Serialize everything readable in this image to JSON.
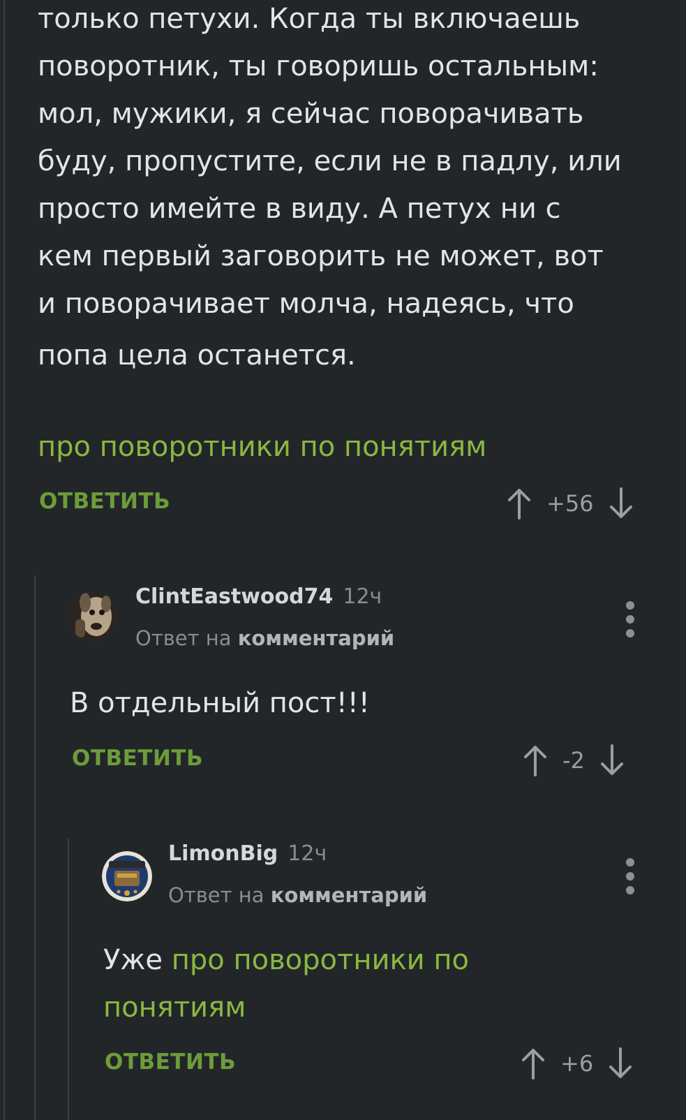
{
  "main_comment": {
    "lines": [
      "только петухи. Когда ты включаешь",
      "поворотник, ты говоришь остальным:",
      "мол, мужики, я сейчас поворачивать",
      "буду, пропустите, если не в падлу, или",
      "просто имейте в виду. А петух ни с",
      "кем первый заговорить не может, вот",
      "и поворачивает молча, надеясь, что",
      "попа цела останется."
    ],
    "post_link": "про поворотники по понятиям",
    "reply_label": "ОТВЕТИТЬ",
    "score": "+56"
  },
  "reply1": {
    "author": "ClintEastwood74",
    "time": "12ч",
    "reply_prefix": "Ответ на",
    "reply_target": "комментарий",
    "text": "В отдельный пост!!!",
    "reply_label": "ОТВЕТИТЬ",
    "score": "-2"
  },
  "reply2": {
    "author": "LimonBig",
    "time": "12ч",
    "reply_prefix": "Ответ на",
    "reply_target": "комментарий",
    "text_plain": "Уже",
    "text_link_line1": "про поворотники по",
    "text_link_line2": "понятиям",
    "reply_label": "ОТВЕТИТЬ",
    "score": "+6"
  },
  "colors": {
    "background": "#222629",
    "accent_green": "#8ab840",
    "reply_green": "#6d9c3a"
  }
}
